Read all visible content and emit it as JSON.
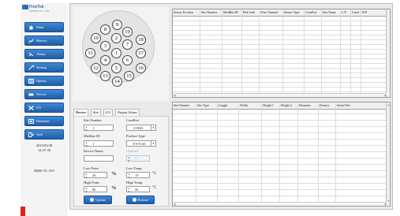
{
  "logo": {
    "brand": "FineTek",
    "tagline": "FINETEK CO., LTD."
  },
  "sidebar": {
    "items": [
      {
        "label": "Main",
        "icon": "home-icon"
      },
      {
        "label": "History",
        "icon": "history-icon"
      },
      {
        "label": "Alarm",
        "icon": "alarm-icon"
      },
      {
        "label": "Setting",
        "icon": "wrench-icon"
      },
      {
        "label": "Option",
        "icon": "option-icon"
      },
      {
        "label": "Device",
        "icon": "device-icon"
      },
      {
        "label": "I/O",
        "icon": "io-icon"
      },
      {
        "label": "Database",
        "icon": "database-icon"
      },
      {
        "label": "Quit",
        "icon": "quit-icon"
      }
    ],
    "date": "2015/03/28",
    "time": "14:27:39",
    "device_code": "MMS-TL-255"
  },
  "connector": {
    "pins": [
      "1",
      "2",
      "3",
      "4",
      "5",
      "6",
      "7",
      "8",
      "9",
      "10",
      "11",
      "12",
      "13",
      "14",
      "15",
      "16",
      "17",
      "18",
      "19"
    ]
  },
  "tabs": [
    "Device",
    "Site",
    "I/O",
    "Output Alarm"
  ],
  "form": {
    "site_number": {
      "label": "Site Number",
      "value": "1"
    },
    "modbus_id": {
      "label": "Modbus ID",
      "value": "1"
    },
    "device_name": {
      "label": "Device Name",
      "value": ""
    },
    "comport": {
      "label": "ComPort",
      "value": "COM1"
    },
    "product_type": {
      "label": "Product Type",
      "value": "EYT120"
    },
    "channel": {
      "label": "Channel",
      "value": "1"
    },
    "low_point": {
      "label": "Low Point",
      "value": "20",
      "unit": "%"
    },
    "high_point": {
      "label": "High Point",
      "value": "80",
      "unit": "%"
    },
    "low_temp": {
      "label": "Low Temp.",
      "value": "15",
      "unit": "°C"
    },
    "high_temp": {
      "label": "High Temp.",
      "value": "30",
      "unit": "°C"
    },
    "update_label": "Update",
    "restore_label": "Restore"
  },
  "top_table": {
    "columns": [
      "Sensor Position",
      "Site Number",
      "ModBus ID",
      "Belt Link",
      "Wire Channel",
      "Sensor Type",
      "ComPort",
      "Site Name",
      "L.P.",
      "Limit",
      "H.P."
    ],
    "row_count": 20
  },
  "bottom_table": {
    "columns": [
      "Site Number",
      "Site Type",
      "Length",
      "Width",
      "Height 1",
      "Height 2",
      "Diameter",
      "Density",
      "Initial Wei"
    ],
    "row_count": 20
  },
  "colors": {
    "button": "#2a6fb8",
    "accent_red": "#d9261c"
  }
}
